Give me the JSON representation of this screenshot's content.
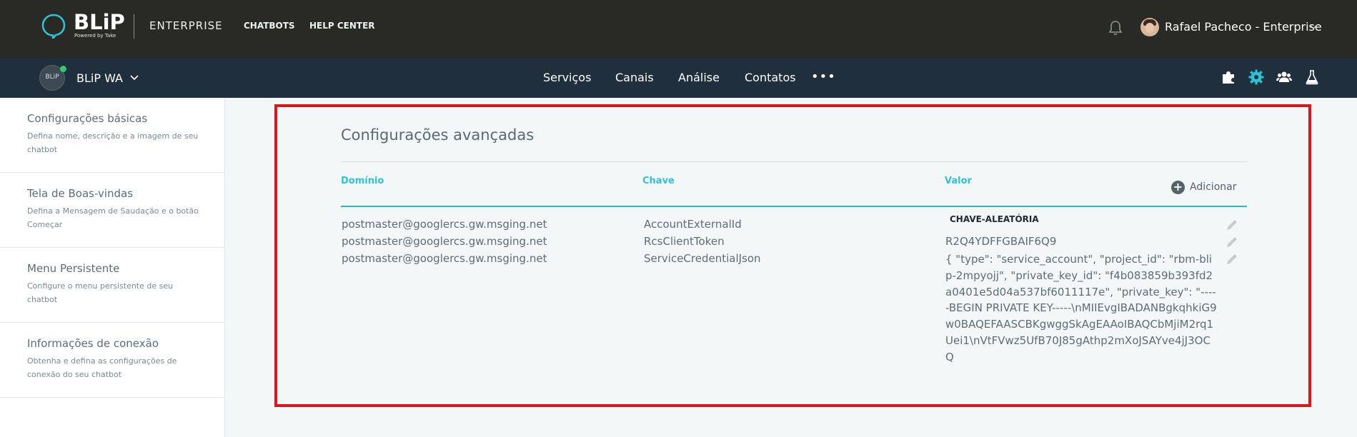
{
  "header": {
    "brand": "BLiP",
    "brand_sub": "Powered by Take",
    "product": "ENTERPRISE",
    "nav": [
      "CHATBOTS",
      "HELP CENTER"
    ],
    "user": "Rafael Pacheco - Enterprise"
  },
  "botbar": {
    "avatar_text": "BLiP",
    "bot_name": "BLiP WA",
    "nav": [
      "Serviços",
      "Canais",
      "Análise",
      "Contatos"
    ],
    "more": "•••",
    "tools": [
      "puzzle-icon",
      "gear-icon",
      "team-icon",
      "flask-icon"
    ],
    "active_tool_color": "#2cc3d5"
  },
  "sidebar": {
    "items": [
      {
        "title": "Configurações básicas",
        "desc": "Defina nome, descrição e a imagem de seu chatbot"
      },
      {
        "title": "Tela de Boas-vindas",
        "desc": "Defina a Mensagem de Saudação e o botão Começar"
      },
      {
        "title": "Menu Persistente",
        "desc": "Configure o menu persistente de seu chatbot"
      },
      {
        "title": "Informações de conexão",
        "desc": "Obtenha e defina as configurações de conexão do seu chatbot"
      }
    ]
  },
  "content": {
    "title": "Configurações avançadas",
    "columns": [
      "Domínio",
      "Chave",
      "Valor"
    ],
    "add_label": "Adicionar",
    "value_tag": "CHAVE-ALEATÓRIA",
    "rows": [
      {
        "domain": "postmaster@googlercs.gw.msging.net",
        "key": "AccountExternalId",
        "value": ""
      },
      {
        "domain": "postmaster@googlercs.gw.msging.net",
        "key": "RcsClientToken",
        "value": "R2Q4YDFFGBAIF6Q9"
      },
      {
        "domain": "postmaster@googlercs.gw.msging.net",
        "key": "ServiceCredentialJson",
        "value": "{ \"type\": \"service_account\", \"project_id\": \"rbm-blip-2mpyojj\", \"private_key_id\": \"f4b083859b393fd2a0401e5d04a537bf6011117e\", \"private_key\": \"-----BEGIN PRIVATE KEY-----\\nMIIEvgIBADANBgkqhkiG9w0BAQEFAASCBKgwggSkAgEAAoIBAQCbMjiM2rq1Uei1\\nVtFVwz5UfB70J85gAthp2mXoJSAYve4jJ3OCQ"
      }
    ]
  },
  "colors": {
    "topbar": "#292a25",
    "subbar": "#1f2f3d",
    "accent": "#2cc3d5",
    "highlight": "#e0141c"
  }
}
